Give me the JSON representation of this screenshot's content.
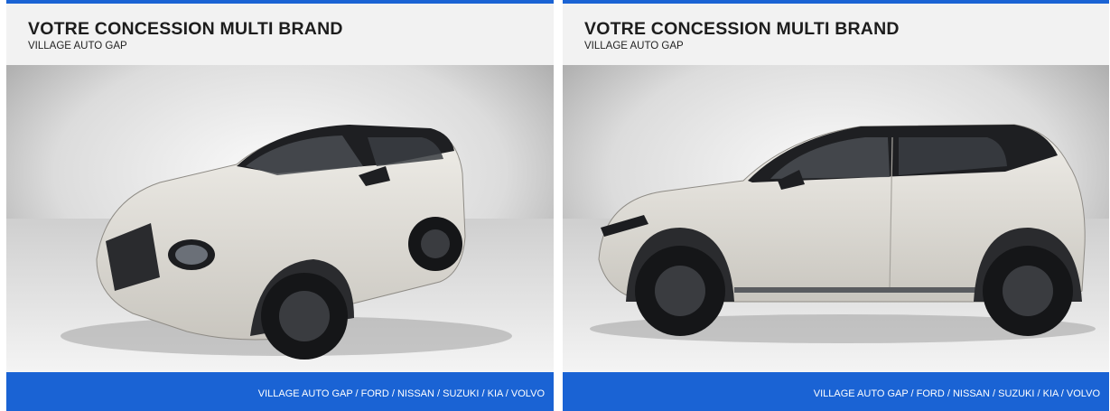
{
  "cards": [
    {
      "title": "VOTRE CONCESSION MULTI BRAND",
      "subtitle": "VILLAGE AUTO GAP",
      "photo_view": "front three-quarter view",
      "footer": "VILLAGE AUTO GAP / FORD / NISSAN / SUZUKI / KIA / VOLVO"
    },
    {
      "title": "VOTRE CONCESSION MULTI BRAND",
      "subtitle": "VILLAGE AUTO GAP",
      "photo_view": "side profile view",
      "footer": "VILLAGE AUTO GAP / FORD / NISSAN / SUZUKI / KIA / VOLVO"
    }
  ],
  "colors": {
    "accent": "#1a63d4",
    "header_bg": "#f2f2f2",
    "car_body": "#e6e3dd",
    "car_roof": "#1e1f22"
  }
}
